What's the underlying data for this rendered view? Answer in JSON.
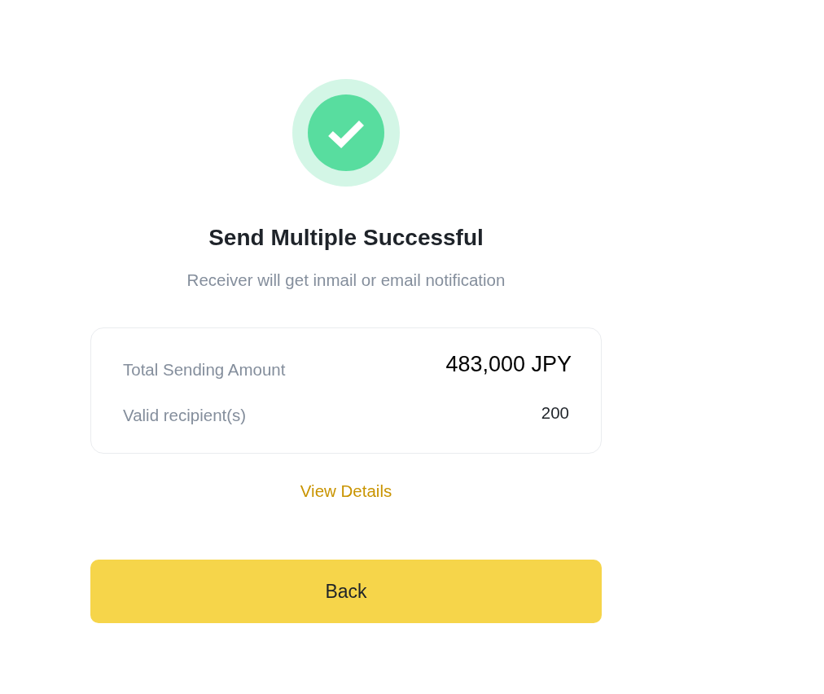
{
  "status": {
    "title": "Send Multiple Successful",
    "subtitle": "Receiver will get inmail or email notification"
  },
  "summary": {
    "rows": [
      {
        "kind": "amount",
        "label": "Total Sending Amount",
        "value": "483,000 JPY"
      },
      {
        "kind": "count",
        "label": "Valid recipient(s)",
        "value": "200"
      }
    ]
  },
  "link": "View Details",
  "button": "Back"
}
